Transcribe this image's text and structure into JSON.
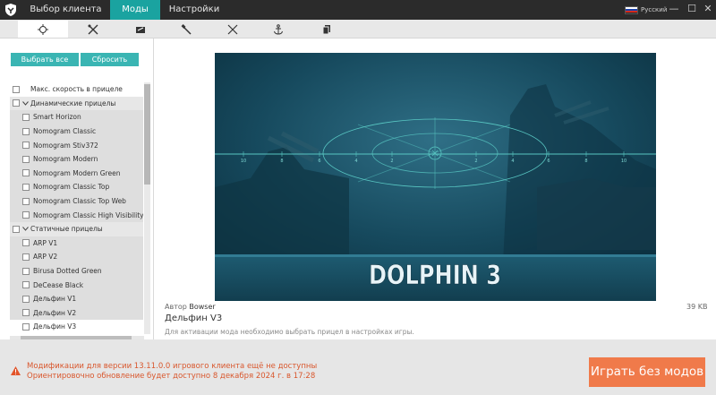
{
  "titlebar": {
    "tabs": [
      {
        "label": "Выбор клиента"
      },
      {
        "label": "Моды"
      },
      {
        "label": "Настройки"
      }
    ],
    "language": "Русский",
    "window_controls": {
      "minimize": "—",
      "maximize": "☐",
      "close": "✕"
    }
  },
  "toolbar": {
    "icons": [
      "crosshair-icon",
      "wrench-cross-icon",
      "gauge-icon",
      "hammer-icon",
      "crossed-swords-icon",
      "anchor-icon",
      "files-icon"
    ]
  },
  "left": {
    "select_all": "Выбрать все",
    "reset": "Сбросить",
    "items": [
      {
        "label": "Макс. скорость в прицеле",
        "kind": "top"
      },
      {
        "label": "Динамические прицелы",
        "kind": "group"
      },
      {
        "label": "Smart Horizon",
        "kind": "sub"
      },
      {
        "label": "Nomogram Classic",
        "kind": "sub"
      },
      {
        "label": "Nomogram Stiv372",
        "kind": "sub"
      },
      {
        "label": "Nomogram Modern",
        "kind": "sub"
      },
      {
        "label": "Nomogram Modern Green",
        "kind": "sub"
      },
      {
        "label": "Nomogram Classic Top",
        "kind": "sub"
      },
      {
        "label": "Nomogram Classic Top Web",
        "kind": "sub"
      },
      {
        "label": "Nomogram Classic High Visibility",
        "kind": "sub"
      },
      {
        "label": "Статичные прицелы",
        "kind": "group"
      },
      {
        "label": "ARP V1",
        "kind": "sub"
      },
      {
        "label": "ARP V2",
        "kind": "sub"
      },
      {
        "label": "Birusa Dotted Green",
        "kind": "sub"
      },
      {
        "label": "DeCease Black",
        "kind": "sub"
      },
      {
        "label": "Дельфин V1",
        "kind": "sub"
      },
      {
        "label": "Дельфин V2",
        "kind": "sub"
      },
      {
        "label": "Дельфин V3",
        "kind": "selected"
      }
    ]
  },
  "preview": {
    "banner": "DOLPHIN 3",
    "scale_labels": [
      "10",
      "8",
      "6",
      "4",
      "2",
      "2",
      "4",
      "6",
      "8",
      "10"
    ]
  },
  "details": {
    "author_label": "Автор",
    "author": "Bowser",
    "size": "39 KB",
    "name": "Дельфин V3",
    "hint": "Для активации мода необходимо выбрать прицел в настройках игры."
  },
  "footer": {
    "warning_line1": "Модификации для версии 13.11.0.0 игрового клиента ещё не доступны",
    "warning_line2": "Ориентировочно обновление будет доступно 8 декабря 2024 г. в 17:28",
    "play_button": "Играть без модов"
  },
  "colors": {
    "accent": "#1aa3a0",
    "button": "#3ab5b3",
    "play": "#f07a4a",
    "warning": "#d9572d",
    "titlebar": "#2b2b2b"
  }
}
